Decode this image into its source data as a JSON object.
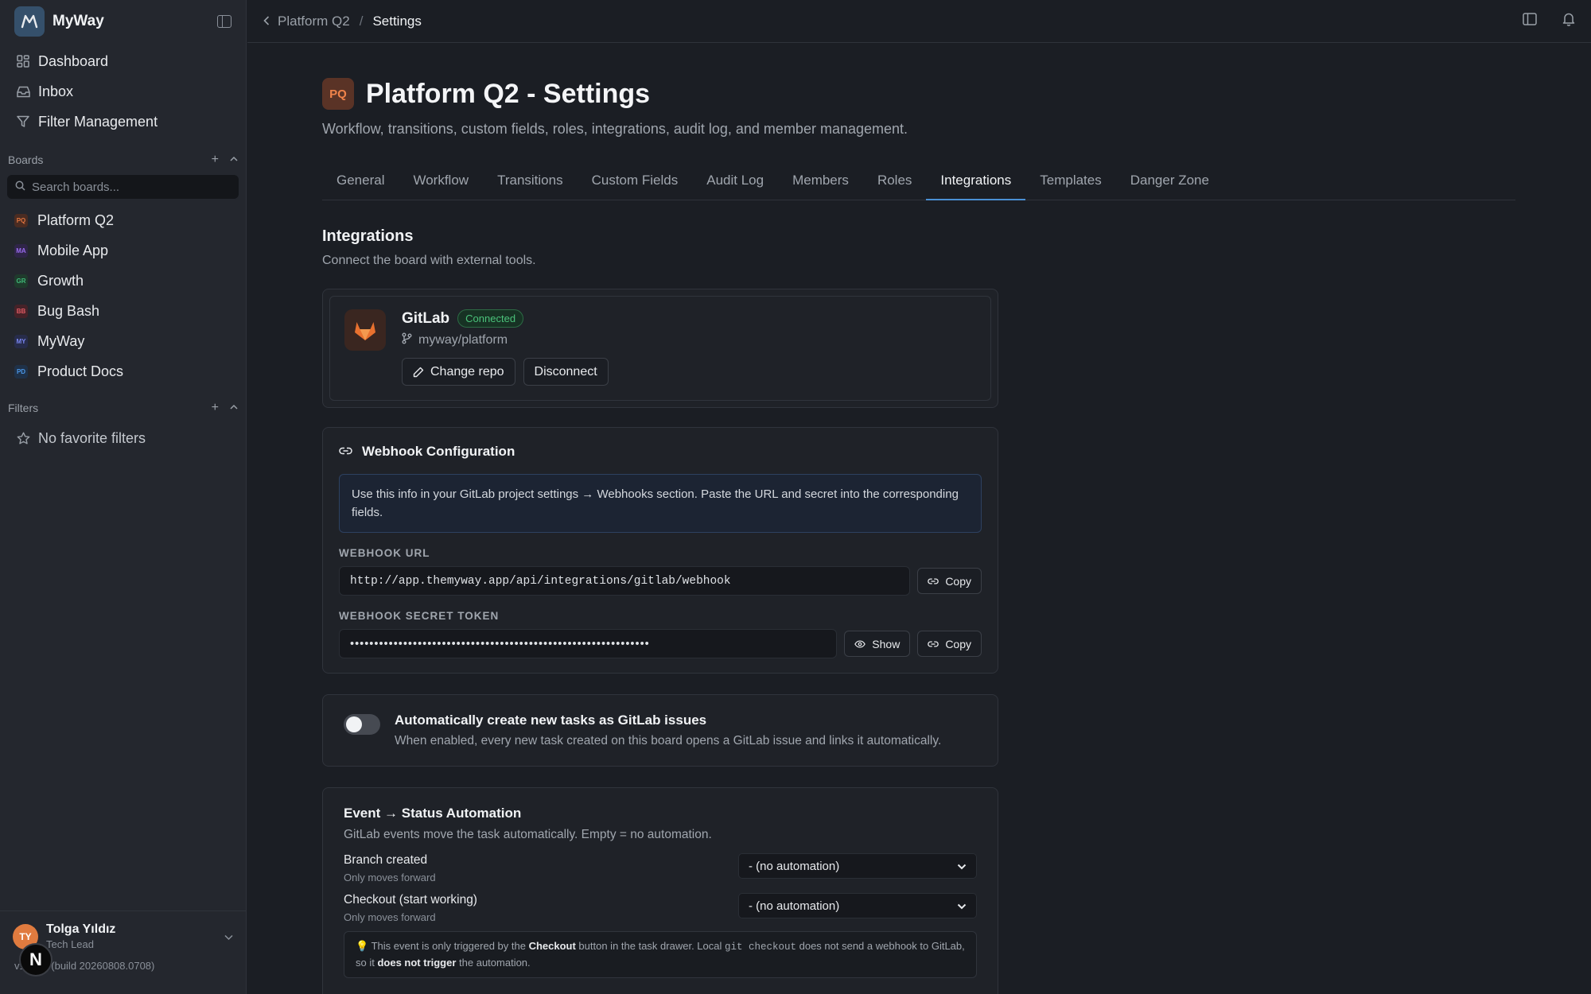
{
  "app": {
    "name": "MyWay"
  },
  "sidebar": {
    "nav": [
      {
        "label": "Dashboard",
        "icon": "dashboard-icon"
      },
      {
        "label": "Inbox",
        "icon": "inbox-icon"
      },
      {
        "label": "Filter Management",
        "icon": "filter-icon"
      }
    ],
    "boards_heading": "Boards",
    "board_search_placeholder": "Search boards...",
    "boards": [
      {
        "abbr": "PQ",
        "label": "Platform Q2",
        "color": "#e0743f",
        "bg": "#4a2c22"
      },
      {
        "abbr": "MA",
        "label": "Mobile App",
        "color": "#9b6cf0",
        "bg": "#2f2548"
      },
      {
        "abbr": "GR",
        "label": "Growth",
        "color": "#3fb978",
        "bg": "#1f3a2c"
      },
      {
        "abbr": "BB",
        "label": "Bug Bash",
        "color": "#e05a63",
        "bg": "#452228"
      },
      {
        "abbr": "MY",
        "label": "MyWay",
        "color": "#7a86f0",
        "bg": "#272c4a"
      },
      {
        "abbr": "PD",
        "label": "Product Docs",
        "color": "#4b97e8",
        "bg": "#1f3148"
      }
    ],
    "filters_heading": "Filters",
    "no_filters": "No favorite filters",
    "user": {
      "initials": "TY",
      "name": "Tolga Yıldız",
      "role": "Tech Lead"
    },
    "version": "v1.15.2 (build 20260808.0708)",
    "n_badge": "N"
  },
  "breadcrumb": {
    "parent": "Platform Q2",
    "separator": "/",
    "current": "Settings"
  },
  "page": {
    "badge": "PQ",
    "title": "Platform Q2 - Settings",
    "subtitle": "Workflow, transitions, custom fields, roles, integrations, audit log, and member management."
  },
  "tabs": [
    "General",
    "Workflow",
    "Transitions",
    "Custom Fields",
    "Audit Log",
    "Members",
    "Roles",
    "Integrations",
    "Templates",
    "Danger Zone"
  ],
  "active_tab": "Integrations",
  "integrations": {
    "title": "Integrations",
    "subtitle": "Connect the board with external tools.",
    "gitlab": {
      "name": "GitLab",
      "status": "Connected",
      "repo": "myway/platform",
      "change_label": "Change repo",
      "disconnect_label": "Disconnect"
    },
    "webhook": {
      "title": "Webhook Configuration",
      "info": "Use this info in your GitLab project settings → Webhooks section. Paste the URL and secret into the corresponding fields.",
      "url_label": "WEBHOOK URL",
      "url": "http://app.themyway.app/api/integrations/gitlab/webhook",
      "copy_label": "Copy",
      "secret_label": "WEBHOOK SECRET TOKEN",
      "secret_masked": "••••••••••••••••••••••••••••••••••••••••••••••••••••••••••••••",
      "show_label": "Show"
    },
    "auto_create": {
      "enabled": false,
      "title": "Automatically create new tasks as GitLab issues",
      "description": "When enabled, every new task created on this board opens a GitLab issue and links it automatically."
    },
    "automation": {
      "title": "Event → Status Automation",
      "subtitle": "GitLab events move the task automatically. Empty = no automation.",
      "rules": [
        {
          "label": "Branch created",
          "hint": "Only moves forward",
          "value": "- (no automation)"
        },
        {
          "label": "Checkout (start working)",
          "hint": "Only moves forward",
          "value": "- (no automation)"
        }
      ],
      "note": {
        "p1": "This event is only triggered by the ",
        "b1": "Checkout",
        "p2": " button in the task drawer. Local ",
        "code": "git checkout",
        "p3": " does not send a webhook to GitLab, so it ",
        "b2": "does not trigger",
        "p4": " the automation."
      }
    }
  }
}
